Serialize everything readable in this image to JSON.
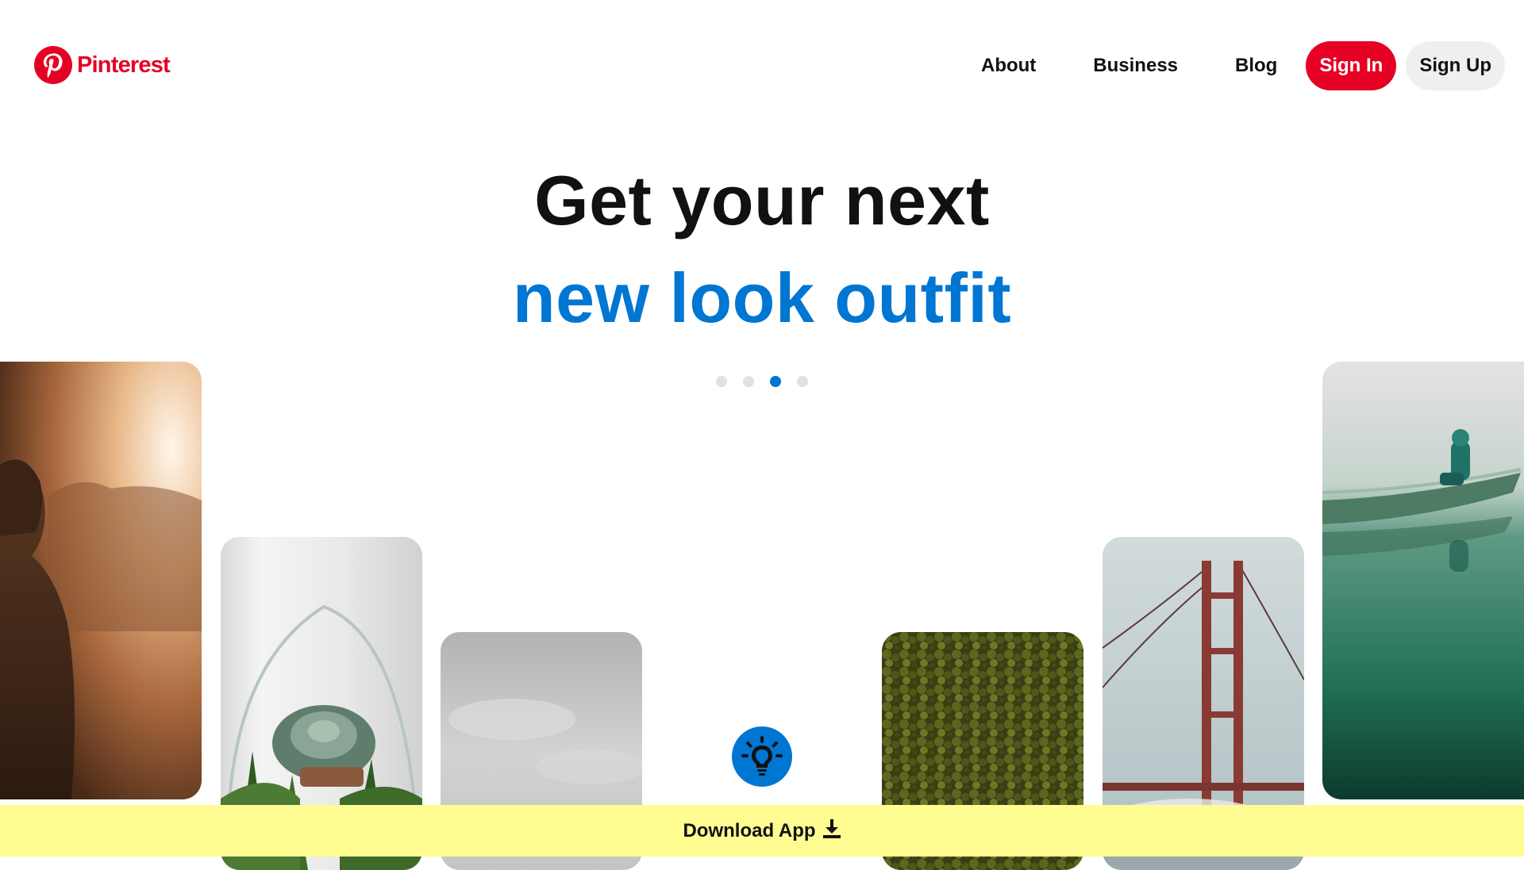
{
  "header": {
    "logo_text": "Pinterest",
    "nav": {
      "about": "About",
      "business": "Business",
      "blog": "Blog"
    },
    "sign_in": "Sign In",
    "sign_up": "Sign Up"
  },
  "hero": {
    "line1": "Get your next",
    "line2": "new look outfit"
  },
  "carousel": {
    "dot_count": 4,
    "active_index": 2
  },
  "pins": [
    {
      "name": "pin-woman-sunset",
      "subject": "woman in warm sunset haze"
    },
    {
      "name": "pin-succulent-terrarium",
      "subject": "succulent terrarium"
    },
    {
      "name": "pin-grey-sky",
      "subject": "overcast grey sky"
    },
    {
      "name": "pin-forest-aerial",
      "subject": "aerial forest canopy"
    },
    {
      "name": "pin-golden-gate",
      "subject": "Golden Gate Bridge in fog"
    },
    {
      "name": "pin-canoe-lake",
      "subject": "person in canoe on green lake"
    }
  ],
  "banner": {
    "label": "Download App"
  },
  "colors": {
    "brand_red": "#e60023",
    "accent_blue": "#0076d3",
    "banner_yellow": "#fffd92",
    "signup_grey": "#efefef"
  },
  "icons": {
    "logo": "pinterest-logo-icon",
    "bulb": "lightbulb-icon",
    "download": "download-icon"
  }
}
